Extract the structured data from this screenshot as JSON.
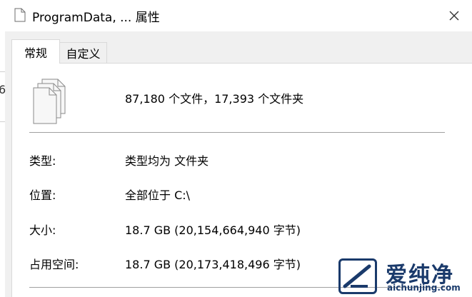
{
  "window": {
    "title": "ProgramData, ... 属性",
    "close_label": "✕"
  },
  "tabs": [
    {
      "label": "常规",
      "selected": true
    },
    {
      "label": "自定义",
      "selected": false
    }
  ],
  "general": {
    "summary": "87,180 个文件，17,393 个文件夹",
    "properties": [
      {
        "label": "类型:",
        "value": "类型均为 文件夹"
      },
      {
        "label": "位置:",
        "value": "全部位于 C:\\"
      },
      {
        "label": "大小:",
        "value": "18.7 GB (20,154,664,940 字节)"
      },
      {
        "label": "占用空间:",
        "value": "18.7 GB (20,173,418,496 字节)"
      }
    ]
  },
  "background": {
    "left_edge_glyph": "6"
  },
  "watermark": {
    "text_cn": "爱纯净",
    "url": "aichunjing.com",
    "color": "#1a3a6b"
  }
}
